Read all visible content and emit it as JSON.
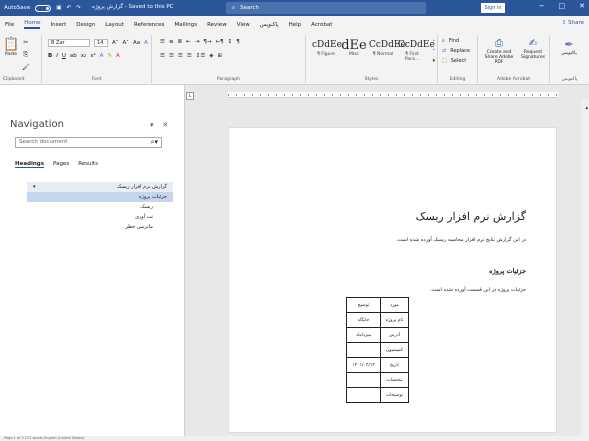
{
  "titlebar": {
    "autosave": "AutoSave",
    "toggle": "Off",
    "title": "گزارش پروژه - Saved to this PC",
    "search_placeholder": "Search",
    "sign_in": "Sign in",
    "window_buttons": [
      "−",
      "□",
      "✕"
    ]
  },
  "tabs": [
    "File",
    "Home",
    "Insert",
    "Design",
    "Layout",
    "References",
    "Mailings",
    "Review",
    "View",
    "پاکنویس",
    "Help",
    "Acrobat"
  ],
  "share": "Share",
  "ribbon": {
    "clipboard": {
      "paste": "Paste",
      "label": "Clipboard"
    },
    "font": {
      "name": "B Zar",
      "size": "14",
      "label": "Font"
    },
    "paragraph": {
      "label": "Paragraph"
    },
    "styles": {
      "items": [
        {
          "preview": "cDdEe",
          "name": "¶ Figure"
        },
        {
          "preview": "dEe",
          "name": "Misc"
        },
        {
          "preview": "CcDdEe",
          "name": "¶ Normal"
        },
        {
          "preview": "CcDdEe",
          "name": "¶ First Para..."
        }
      ],
      "label": "Styles"
    },
    "editing": {
      "find": "Find",
      "replace": "Replace",
      "select": "Select",
      "label": "Editing"
    },
    "acrobat": {
      "create": "Create and Share Adobe PDF",
      "request": "Request Signatures",
      "label": "Adobe Acrobat"
    },
    "paknevis": {
      "name": "پاکنویس",
      "label": "پاکنویس"
    }
  },
  "nav": {
    "title": "Navigation",
    "search_placeholder": "Search document",
    "tabs": [
      "Headings",
      "Pages",
      "Results"
    ],
    "items": [
      {
        "label": "گزارش نرم افزار ریسک",
        "state": "top"
      },
      {
        "label": "جزئیات پروژه",
        "state": "sel"
      },
      {
        "label": "ریسک",
        "state": "indent"
      },
      {
        "label": "تب آوری",
        "state": "indent"
      },
      {
        "label": "ماتریس خطر",
        "state": "indent"
      }
    ]
  },
  "document": {
    "title": "گزارش نرم افزار ریسک",
    "intro": "در این گزارش نتایج نرم افزار محاسبه ریسک آورده شده است.",
    "section": "جزئیات پروژه",
    "section_text": "جزئیات پروژه در این قسمت آورده شده است.",
    "table": {
      "header": [
        "مورد",
        "توضیح"
      ],
      "rows": [
        [
          "نام پروژه",
          "جایگاه"
        ],
        [
          "آدرس",
          "میرداماد"
        ],
        [
          "کمیسیون",
          ""
        ],
        [
          "تاریخ",
          "۱۴۰۱/۰۳/۱۳"
        ],
        [
          "مختصات",
          ""
        ],
        [
          "توضیحات",
          ""
        ]
      ]
    }
  },
  "statusbar": "Page 1 of 3   217 words   English (United States)"
}
